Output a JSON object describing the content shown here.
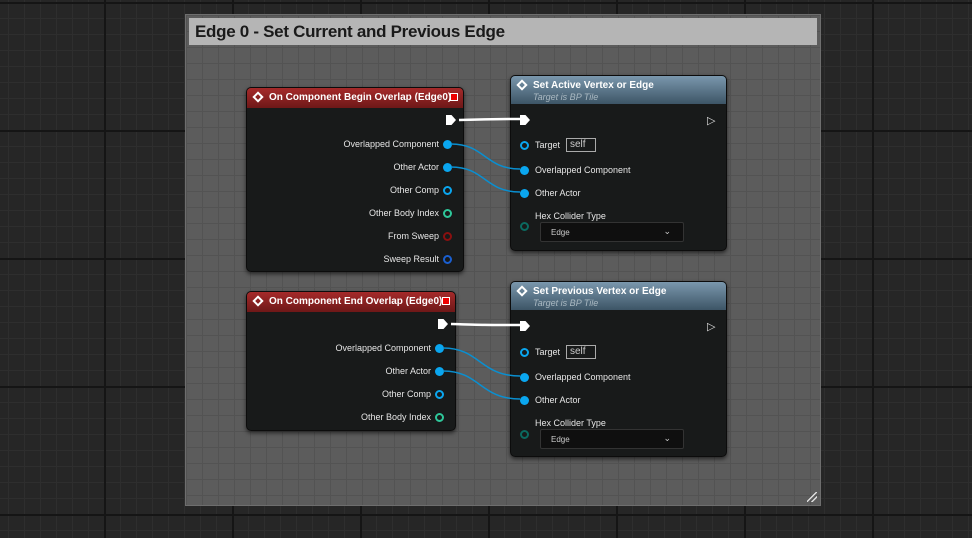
{
  "comment": {
    "title": "Edge 0 - Set Current and Previous Edge"
  },
  "begin_overlap": {
    "title": "On Component Begin Overlap (Edge0)",
    "pins": [
      "Overlapped Component",
      "Other Actor",
      "Other Comp",
      "Other Body Index",
      "From Sweep",
      "Sweep Result"
    ]
  },
  "end_overlap": {
    "title": "On Component End Overlap (Edge0)",
    "pins": [
      "Overlapped Component",
      "Other Actor",
      "Other Comp",
      "Other Body Index"
    ]
  },
  "set_active": {
    "title": "Set Active Vertex or Edge",
    "subtitle": "Target is BP Tile",
    "target_label": "Target",
    "target_value": "self",
    "pins": [
      "Overlapped Component",
      "Other Actor"
    ],
    "hex_label": "Hex Collider Type",
    "hex_value": "Edge"
  },
  "set_previous": {
    "title": "Set Previous Vertex or Edge",
    "subtitle": "Target is BP Tile",
    "target_label": "Target",
    "target_value": "self",
    "pins": [
      "Overlapped Component",
      "Other Actor"
    ],
    "hex_label": "Hex Collider Type",
    "hex_value": "Edge"
  },
  "colors": {
    "object_pin": "#0aa6ef",
    "int_pin": "#2ec79a",
    "bool_pin": "#8a1010",
    "struct_pin": "#1a5fd0",
    "event_header": "#a52a2a",
    "function_header": "#7a97ad"
  }
}
